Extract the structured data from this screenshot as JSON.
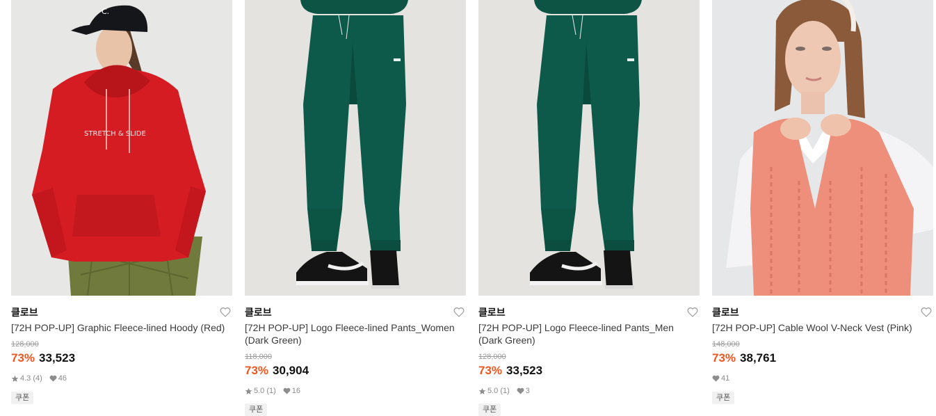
{
  "products": [
    {
      "brand": "클로브",
      "name": "[72H POP-UP] Graphic Fleece-lined Hoody (Red)",
      "original_price": "128,000",
      "discount": "73%",
      "sale_price": "33,523",
      "rating": "4.3 (4)",
      "likes": "46",
      "badge": "쿠폰",
      "print_text": "STRETCH & SLIDE",
      "main_color": "#d51c23"
    },
    {
      "brand": "클로브",
      "name": "[72H POP-UP] Logo Fleece-lined Pants_Women (Dark Green)",
      "original_price": "118,000",
      "discount": "73%",
      "sale_price": "30,904",
      "rating": "5.0 (1)",
      "likes": "16",
      "badge": "쿠폰",
      "main_color": "#0e5a4a"
    },
    {
      "brand": "클로브",
      "name": "[72H POP-UP] Logo Fleece-lined Pants_Men (Dark Green)",
      "original_price": "128,000",
      "discount": "73%",
      "sale_price": "33,523",
      "rating": "5.0 (1)",
      "likes": "3",
      "badge": "쿠폰",
      "main_color": "#0e5a4a"
    },
    {
      "brand": "클로브",
      "name": "[72H POP-UP] Cable Wool V-Neck Vest (Pink)",
      "original_price": "148,000",
      "discount": "73%",
      "sale_price": "38,761",
      "likes": "41",
      "badge": "쿠폰",
      "main_color": "#ee8f7c"
    }
  ],
  "colors": {
    "discount": "#ef5620",
    "badge_bg": "#f1f1f1",
    "photo_bg": "#e5e4e1"
  },
  "icons": {
    "wishlist": "heart-outline-icon",
    "rating": "star-icon",
    "likes": "heart-filled-icon"
  }
}
